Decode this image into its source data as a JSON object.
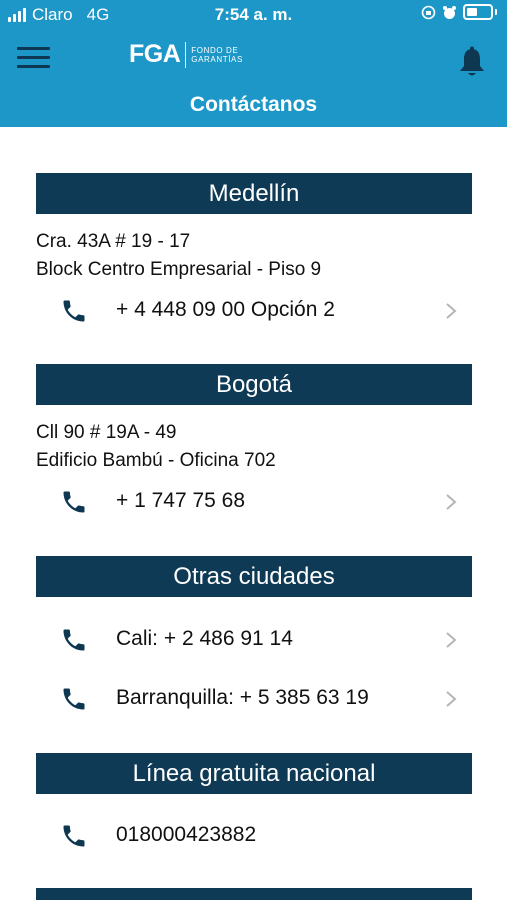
{
  "status": {
    "carrier": "Claro",
    "network": "4G",
    "time": "7:54 a. m."
  },
  "header": {
    "logo_text": "FGA",
    "logo_sub_line1": "FONDO DE",
    "logo_sub_line2": "GARANTÍAS",
    "title": "Contáctanos"
  },
  "sections": {
    "medellin": {
      "title": "Medellín",
      "addr1": "Cra. 43A # 19 - 17",
      "addr2": "Block Centro Empresarial - Piso 9",
      "phone": "+ 4 448 09 00 Opción 2"
    },
    "bogota": {
      "title": "Bogotá",
      "addr1": "Cll 90 # 19A - 49",
      "addr2": "Edificio Bambú - Oficina 702",
      "phone": "+ 1 747 75 68"
    },
    "otras": {
      "title": "Otras ciudades",
      "phone1": "Cali: + 2 486 91 14",
      "phone2": "Barranquilla: + 5 385 63 19"
    },
    "linea": {
      "title": "Línea gratuita nacional",
      "phone": "018000423882"
    }
  },
  "icons": {
    "menu": "hamburger-menu-icon",
    "bell": "bell-icon",
    "phone": "phone-icon",
    "chevron": "chevron-right-icon"
  },
  "colors": {
    "header": "#1d97c8",
    "section_bar": "#0f3a56",
    "icon": "#0e3752"
  }
}
